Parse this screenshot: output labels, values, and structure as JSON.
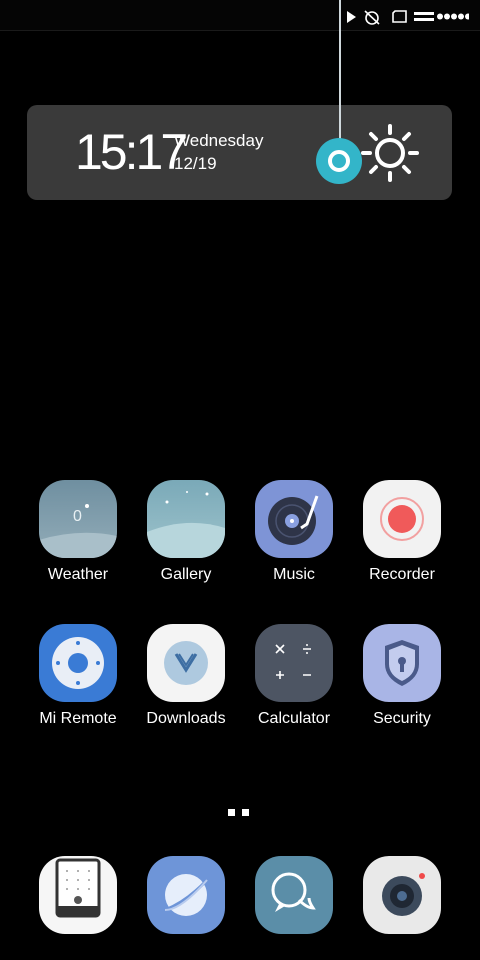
{
  "status_bar": {
    "icons": [
      "play-icon",
      "alarm-off-icon",
      "sim-card-icon",
      "battery-icon",
      "signal-dots-icon"
    ]
  },
  "widget": {
    "time": "15:17",
    "day": "Wednesday",
    "date": "12/19",
    "icons": [
      "toggle-handle-icon",
      "sun-icon"
    ]
  },
  "apps": [
    {
      "label": "Weather",
      "icon": "weather-icon",
      "badge": "0"
    },
    {
      "label": "Gallery",
      "icon": "gallery-icon"
    },
    {
      "label": "Music",
      "icon": "music-icon"
    },
    {
      "label": "Recorder",
      "icon": "recorder-icon"
    },
    {
      "label": "Mi Remote",
      "icon": "remote-icon"
    },
    {
      "label": "Downloads",
      "icon": "downloads-icon"
    },
    {
      "label": "Calculator",
      "icon": "calculator-icon"
    },
    {
      "label": "Security",
      "icon": "security-icon"
    }
  ],
  "dock": [
    "phone-icon",
    "browser-icon",
    "messages-icon",
    "camera-icon"
  ],
  "page_indicator": {
    "count": 2
  }
}
